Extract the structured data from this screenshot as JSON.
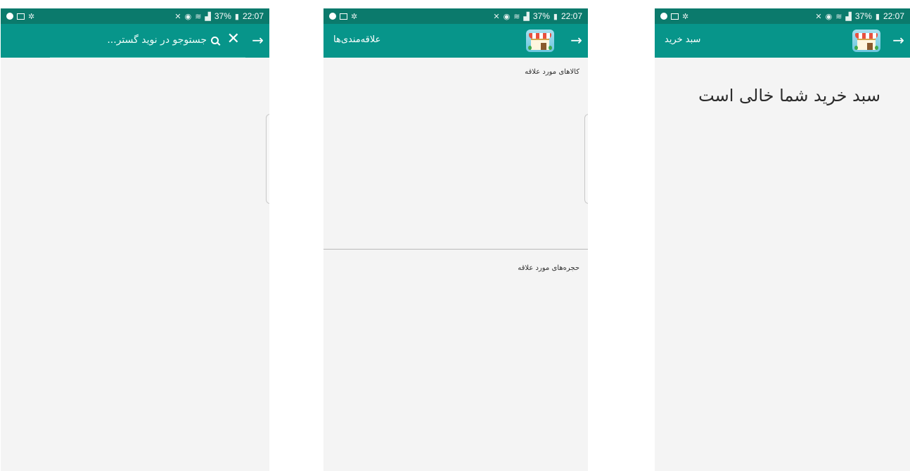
{
  "status_bar": {
    "battery": "37%",
    "time": "22:07",
    "icons": [
      "vpn-icon",
      "screen-icon",
      "tool-icon",
      "mute-icon",
      "alarm-icon",
      "wifi-icon",
      "signal-icon",
      "battery-icon"
    ]
  },
  "search_screen": {
    "placeholder": "جستوجو در نوید گستر...",
    "close_glyph": "✕",
    "back_glyph": "→"
  },
  "favorites_screen": {
    "title": "علاقه‌مندی‌ها",
    "back_glyph": "→",
    "products_label": "کالاهای مورد علاقه",
    "shops_label": "حجره‌های مورد علاقه"
  },
  "cart_screen": {
    "title": "سبد خرید",
    "back_glyph": "→",
    "empty_message": "سبد خرید شما خالی است"
  },
  "colors": {
    "status_bar": "#0b7a6c",
    "app_bar": "#07958a",
    "background": "#f4f4f4"
  }
}
